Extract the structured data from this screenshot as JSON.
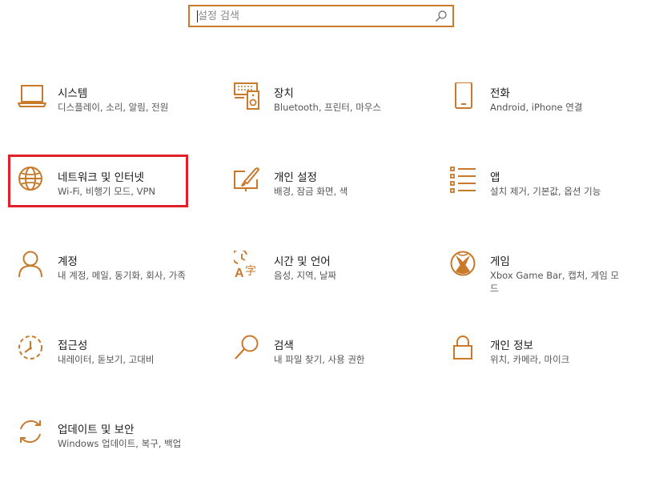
{
  "search": {
    "placeholder": "설정 검색",
    "value": ""
  },
  "accent_color": "#c8792a",
  "highlight_color": "#e0202a",
  "categories": [
    {
      "id": "system",
      "icon": "laptop-icon",
      "title": "시스템",
      "desc": "디스플레이, 소리, 알림, 전원"
    },
    {
      "id": "devices",
      "icon": "devices-icon",
      "title": "장치",
      "desc": "Bluetooth, 프린터, 마우스"
    },
    {
      "id": "phone",
      "icon": "phone-icon",
      "title": "전화",
      "desc": "Android, iPhone 연결"
    },
    {
      "id": "network",
      "icon": "globe-icon",
      "title": "네트워크 및 인터넷",
      "desc": "Wi-Fi, 비행기 모드, VPN"
    },
    {
      "id": "personalization",
      "icon": "paint-brush-icon",
      "title": "개인 설정",
      "desc": "배경, 잠금 화면, 색"
    },
    {
      "id": "apps",
      "icon": "apps-list-icon",
      "title": "앱",
      "desc": "설치 제거, 기본값, 옵션 기능"
    },
    {
      "id": "accounts",
      "icon": "person-icon",
      "title": "계정",
      "desc": "내 계정, 메일, 동기화, 회사, 가족"
    },
    {
      "id": "time-language",
      "icon": "language-icon",
      "title": "시간 및 언어",
      "desc": "음성, 지역, 날짜"
    },
    {
      "id": "gaming",
      "icon": "xbox-icon",
      "title": "게임",
      "desc": "Xbox Game Bar, 캡처, 게임 모드"
    },
    {
      "id": "ease-of-access",
      "icon": "ease-of-access-icon",
      "title": "접근성",
      "desc": "내레이터, 돋보기, 고대비"
    },
    {
      "id": "search",
      "icon": "magnifier-icon",
      "title": "검색",
      "desc": "내 파일 찾기, 사용 권한"
    },
    {
      "id": "privacy",
      "icon": "lock-icon",
      "title": "개인 정보",
      "desc": "위치, 카메라, 마이크"
    },
    {
      "id": "update-security",
      "icon": "sync-icon",
      "title": "업데이트 및 보안",
      "desc": "Windows 업데이트, 복구, 백업"
    }
  ]
}
